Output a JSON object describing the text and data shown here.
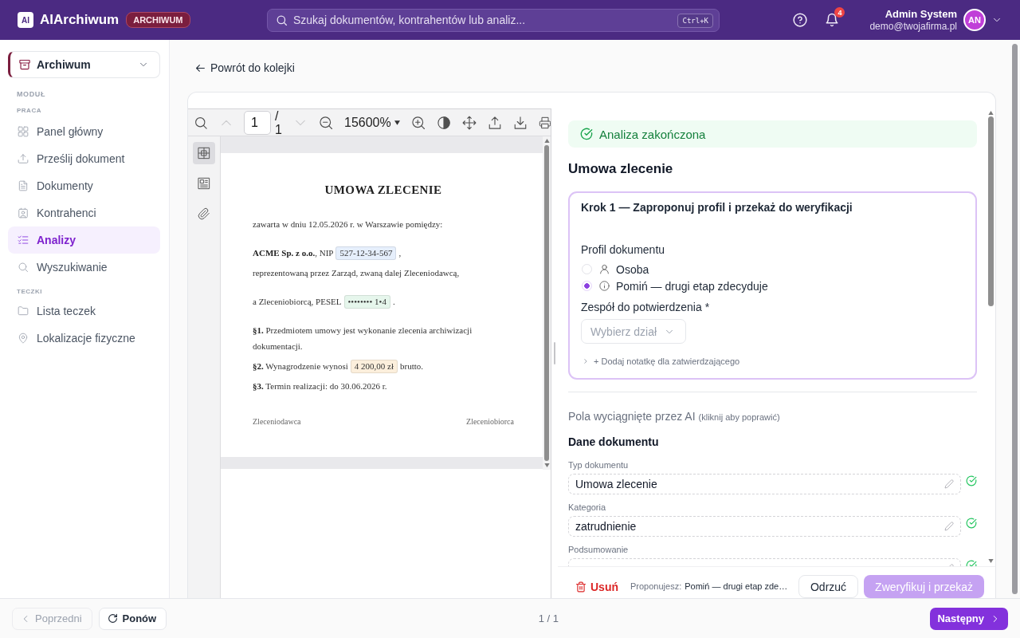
{
  "app": {
    "logo": "AI",
    "name": "AIArchiwum",
    "badge": "ARCHIWUM"
  },
  "search": {
    "placeholder": "Szukaj dokumentów, kontrahentów lub analiz...",
    "shortcut": "Ctrl+K"
  },
  "notifications": {
    "count": "4"
  },
  "user": {
    "name": "Admin System",
    "email": "demo@twojafirma.pl",
    "initials": "AN"
  },
  "sidebar": {
    "module_switch": {
      "label": "Archiwum"
    },
    "module_heading": "MODUŁ",
    "sections": [
      {
        "heading": "PRACA",
        "items": [
          {
            "label": "Panel główny",
            "selected": false
          },
          {
            "label": "Prześlij dokument",
            "selected": false
          },
          {
            "label": "Dokumenty",
            "selected": false
          },
          {
            "label": "Kontrahenci",
            "selected": false
          },
          {
            "label": "Analizy",
            "selected": true
          },
          {
            "label": "Wyszukiwanie",
            "selected": false
          }
        ]
      },
      {
        "heading": "TECZKI",
        "items": [
          {
            "label": "Lista teczek",
            "selected": false
          },
          {
            "label": "Lokalizacje fizyczne",
            "selected": false
          }
        ]
      }
    ]
  },
  "back_link": "Powrót do kolejki",
  "viewer": {
    "toolbar": {
      "prev_page_disabled": true,
      "page": "1",
      "page_total": "/ 1",
      "next_page_disabled": true,
      "zoom": "15600%"
    },
    "side_tabs": [
      {
        "selected": true
      },
      {
        "selected": false
      },
      {
        "selected": false
      }
    ],
    "document": {
      "title": "UMOWA ZLECENIE",
      "blocks": [
        {
          "paragraphs": [
            {
              "text": "zawarta w dniu 12.05.2026 r. w Warszawie pomiędzy:"
            }
          ]
        },
        {
          "paragraphs": [
            {
              "text": "**ACME Sp. z o.o.**, NIP",
              "highlight": {
                "text": "527-12-34-567",
                "color": "#e6effc"
              },
              "after": ","
            },
            {
              "text": "reprezentowaną przez Zarząd, zwaną dalej Zleceniodawcą,"
            }
          ]
        },
        {
          "paragraphs": [
            {
              "text": "a Zleceniobiorcą, PESEL",
              "highlight": {
                "text": "•••••••• 1•4",
                "color": "#e6f6ec"
              },
              "after": "."
            }
          ]
        },
        {
          "paragraphs": [
            {
              "text": "**§1.** Przedmiotem umowy jest wykonanie zlecenia archiwizacji dokumentacji."
            },
            {
              "text": "**§2.** Wynagrodzenie wynosi",
              "highlight": {
                "text": "4 200,00 zł",
                "color": "#fcefdc"
              },
              "after": "brutto."
            },
            {
              "text": "**§3.** Termin realizacji: do 30.06.2026 r."
            }
          ]
        }
      ],
      "signatures": [
        "Zleceniodawca",
        "Zleceniobiorca"
      ]
    }
  },
  "analysis": {
    "status": "Analiza zakończona",
    "title": "Umowa zlecenie",
    "step": {
      "title": "Krok 1 — Zaproponuj profil i przekaż do weryfikacji",
      "profile_label": "Profil dokumentu",
      "options": [
        {
          "label": "Osoba",
          "selected": false
        },
        {
          "label": "Pomiń — drugi etap zdecyduje",
          "selected": true
        }
      ],
      "team_label": "Zespół do potwierdzenia *",
      "team_select": {
        "placeholder": "Wybierz dział"
      },
      "note_toggle": "+ Dodaj notatkę dla zatwierdzającego"
    },
    "fields_heading": {
      "text": "Pola wyciągnięte przez AI",
      "hint": "(kliknij aby poprawić)"
    },
    "section_title": "Dane dokumentu",
    "fields": [
      {
        "label": "Typ dokumentu",
        "value": "Umowa zlecenie",
        "verified": true
      },
      {
        "label": "Kategoria",
        "value": "zatrudnienie",
        "verified": true
      },
      {
        "label": "Podsumowanie",
        "verified": true
      }
    ]
  },
  "actions": {
    "delete": "Usuń",
    "proposal_label": "Proponujesz:",
    "proposal_value": "Pomiń — drugi etap zde…",
    "reject": "Odrzuć",
    "submit": {
      "label": "Zweryfikuj i przekaż",
      "disabled": true
    }
  },
  "pager": {
    "previous": {
      "label": "Poprzedni",
      "disabled": true
    },
    "retry": "Ponów",
    "position": "1 / 1",
    "next": "Następny"
  }
}
